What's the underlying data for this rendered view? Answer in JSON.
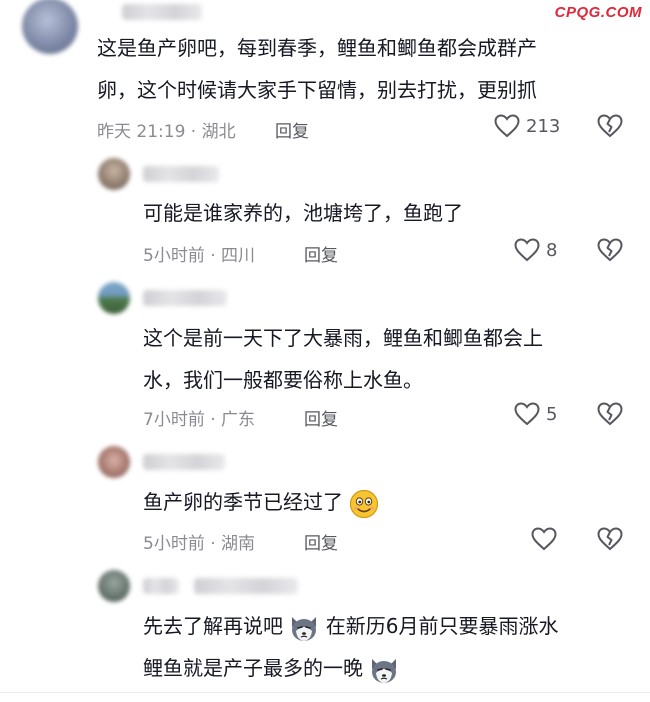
{
  "watermark": "CPQG.COM",
  "comments": [
    {
      "lines": [
        "这是鱼产卵吧，每到春季，鲤鱼和鲫鱼都会成群产",
        "卵，这个时候请大家手下留情，别去打扰，更别抓"
      ],
      "time_location": "昨天 21:19 · 湖北",
      "reply_label": "回复",
      "likes": "213"
    },
    {
      "lines": [
        "可能是谁家养的，池塘垮了，鱼跑了"
      ],
      "time_location": "5小时前 · 四川",
      "reply_label": "回复",
      "likes": "8"
    },
    {
      "lines": [
        "这个是前一天下了大暴雨，鲤鱼和鲫鱼都会上",
        "水，我们一般都要俗称上水鱼。"
      ],
      "time_location": "7小时前 · 广东",
      "reply_label": "回复",
      "likes": "5"
    },
    {
      "lines": [
        "鱼产卵的季节已经过了"
      ],
      "time_location": "5小时前 · 湖南",
      "reply_label": "回复",
      "likes": ""
    },
    {
      "line1_part1": "先去了解再说吧",
      "line1_part2": "在新历6月前只要暴雨涨水",
      "line2": "鲤鱼就是产子最多的一晚"
    }
  ],
  "icons": {
    "like": "heart-outline-icon",
    "dislike": "broken-heart-icon",
    "emoji_smile": "smiling-face-emoji",
    "emoji_husky": "husky-dog-emoji"
  }
}
